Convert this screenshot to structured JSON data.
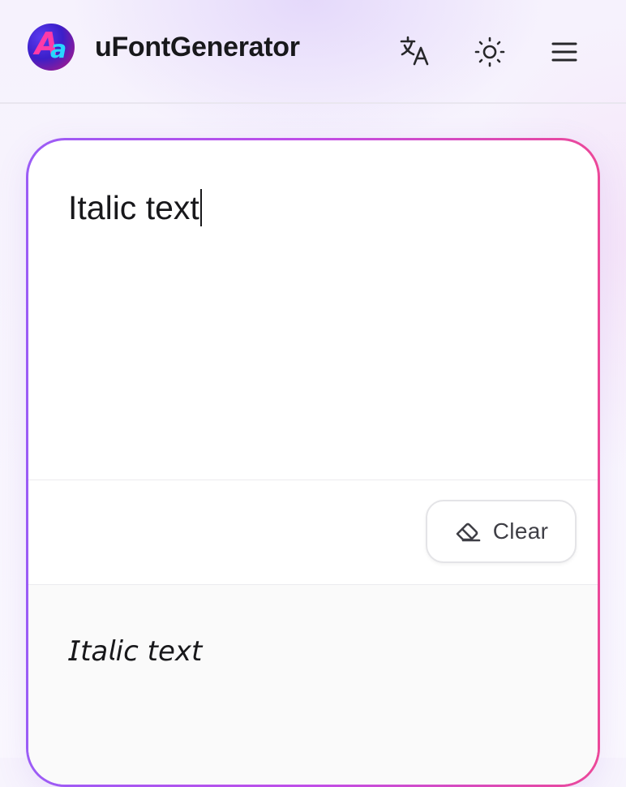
{
  "app": {
    "title": "uFontGenerator",
    "logo_text": "Aa"
  },
  "header": {
    "icons": [
      "translate-icon",
      "sun-icon",
      "menu-icon"
    ]
  },
  "editor": {
    "input_value": "Italic text",
    "clear_label": "Clear",
    "output_text": "𝘐𝘵𝘢𝘭𝘪𝘤 𝘵𝘦𝘹𝘵"
  },
  "colors": {
    "border_gradient_start": "#9b5cf6",
    "border_gradient_end": "#ec4899",
    "text": "#18181b"
  }
}
